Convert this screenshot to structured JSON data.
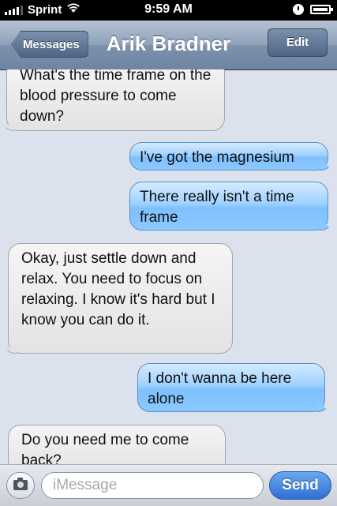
{
  "status_bar": {
    "carrier": "Sprint",
    "time": "9:59 AM"
  },
  "nav": {
    "back_label": "Messages",
    "title": "Arik Bradner",
    "edit_label": "Edit"
  },
  "messages": [
    {
      "direction": "incoming",
      "text": "What's the time frame on the blood pressure to come down?"
    },
    {
      "direction": "outgoing",
      "text": "I've got the magnesium"
    },
    {
      "direction": "outgoing",
      "text": "There really isn't a time frame"
    },
    {
      "direction": "incoming",
      "text": "Okay, just settle down and relax.  You need to focus on relaxing.  I know it's hard but I know you can do it."
    },
    {
      "direction": "outgoing",
      "text": "I don't wanna be here alone"
    },
    {
      "direction": "incoming",
      "text": "Do you need me to come back?"
    }
  ],
  "composer": {
    "placeholder": "iMessage",
    "send_label": "Send"
  },
  "colors": {
    "incoming_bubble": "#e8e8e8",
    "outgoing_bubble": "#8bc8ff",
    "nav_bar": "#7d91ab",
    "send_button": "#2f6fd4"
  }
}
